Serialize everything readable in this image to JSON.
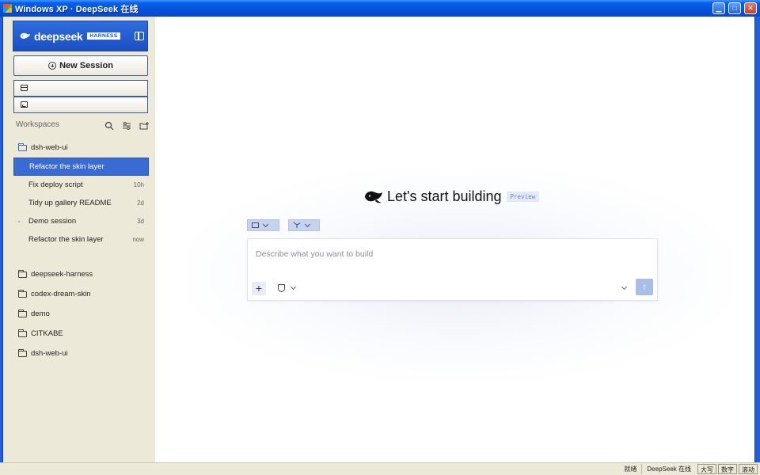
{
  "window": {
    "title": "Windows XP · DeepSeek 在线",
    "controls": [
      "minimize",
      "maximize",
      "close"
    ]
  },
  "sidebar": {
    "brand": {
      "name": "deepseek",
      "badge": "HARNESS"
    },
    "new_session_label": "New Session",
    "workspaces_label": "Workspaces",
    "active_workspace": {
      "name": "dsh-web-ui",
      "sessions": [
        {
          "title": "Refactor the skin layer",
          "age": "",
          "active": true
        },
        {
          "title": "Fix deploy script",
          "age": "10h"
        },
        {
          "title": "Tidy up gallery README",
          "age": "2d"
        },
        {
          "title": "Demo session",
          "age": "3d"
        },
        {
          "title": "Refactor the skin layer",
          "age": "now"
        }
      ]
    },
    "other_workspaces": [
      "deepseek-harness",
      "codex-dream-skin",
      "demo",
      "CITKABE",
      "dsh-web-ui"
    ]
  },
  "main": {
    "hero_title": "Let's start building",
    "preview_badge": "Preview",
    "composer": {
      "placeholder": "Describe what you want to build"
    },
    "attach_label": "+",
    "send_label": "↑"
  },
  "statusbar": {
    "ready": "就绪",
    "app": "DeepSeek 在线",
    "caps": "大写",
    "num": "数字",
    "scroll": "滚动"
  },
  "colors": {
    "accent": "#3a6bd2",
    "titlebar": "#0353dc",
    "sidebar_bg": "#ede9d8"
  }
}
